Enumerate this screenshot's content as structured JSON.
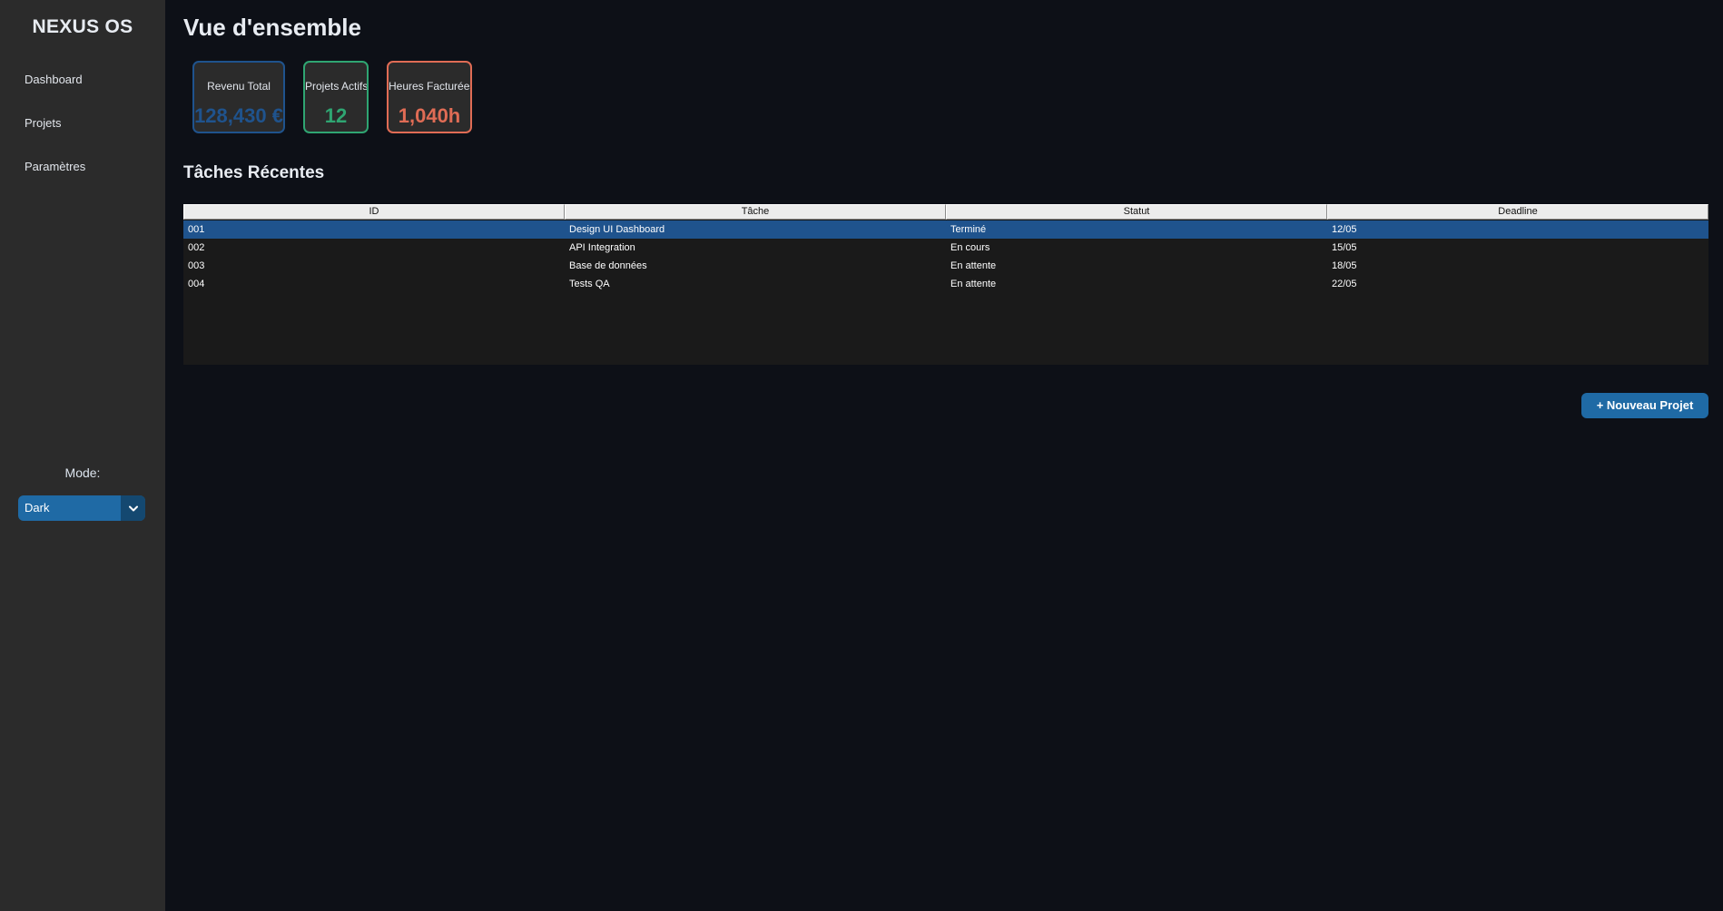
{
  "sidebar": {
    "brand": "NEXUS OS",
    "nav": [
      {
        "label": "Dashboard"
      },
      {
        "label": "Projets"
      },
      {
        "label": "Paramètres"
      }
    ],
    "mode_label": "Mode:",
    "mode_value": "Dark"
  },
  "main": {
    "title": "Vue d'ensemble",
    "kpis": [
      {
        "label": "Revenu Total",
        "value": "128,430 €",
        "color": "#1f538d"
      },
      {
        "label": "Projets Actifs",
        "value": "12",
        "color": "#2fa572"
      },
      {
        "label": "Heures Facturées",
        "value": "1,040h",
        "color": "#e06c55"
      }
    ],
    "section_title": "Tâches Récentes",
    "table": {
      "columns": [
        "ID",
        "Tâche",
        "Statut",
        "Deadline"
      ],
      "rows": [
        [
          "001",
          "Design UI Dashboard",
          "Terminé",
          "12/05"
        ],
        [
          "002",
          "API Integration",
          "En cours",
          "15/05"
        ],
        [
          "003",
          "Base de données",
          "En attente",
          "18/05"
        ],
        [
          "004",
          "Tests QA",
          "En attente",
          "22/05"
        ]
      ],
      "selected_row": 0
    },
    "new_button": "+ Nouveau Projet"
  },
  "colors": {
    "accent": "#1f6aa5",
    "selection": "#1f538d",
    "background": "#0d1017",
    "sidebar": "#2b2b2b"
  },
  "icons": {
    "mode_dropdown": "chevron-down-icon"
  }
}
